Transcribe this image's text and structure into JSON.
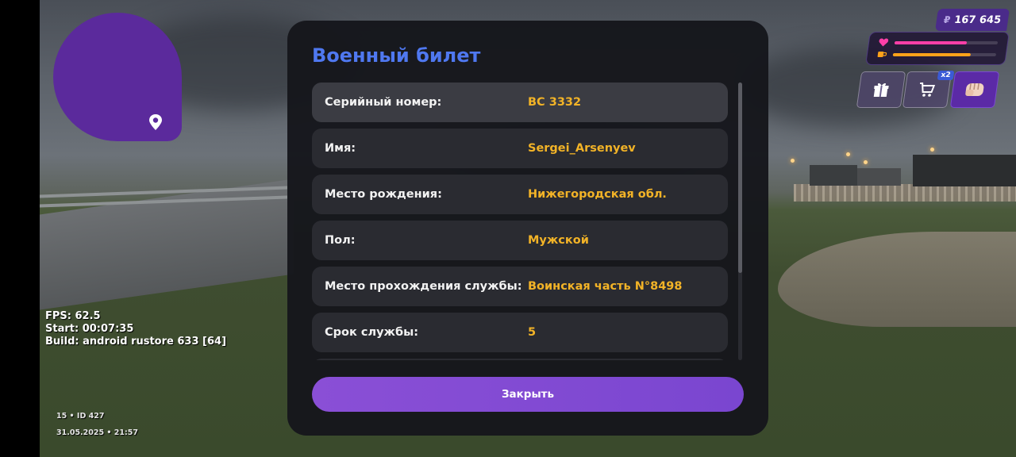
{
  "hud": {
    "money_currency": "₽",
    "money_amount": "167 645",
    "health_level": 0.7,
    "hunger_level": 0.75,
    "health_color": "#ff3fa8",
    "hunger_color": "#ffa21a",
    "cart_badge": "x2",
    "buttons": [
      "gift-icon",
      "cart-icon",
      "fist-icon"
    ]
  },
  "debug": {
    "fps": "FPS: 62.5",
    "start": "Start: 00:07:35",
    "build": "Build: android rustore 633 [64]"
  },
  "meta": {
    "line1": "15 • ID 427",
    "line2": "31.05.2025 • 21:57"
  },
  "modal": {
    "title": "Военный билет",
    "rows": [
      {
        "label": "Серийный номер:",
        "value": "ВС 3332"
      },
      {
        "label": "Имя:",
        "value": "Sergei_Arsenyev"
      },
      {
        "label": "Место рождения:",
        "value": "Нижегородская обл."
      },
      {
        "label": "Пол:",
        "value": "Мужской"
      },
      {
        "label": "Место прохождения службы:",
        "value": "Воинская часть N°8498"
      },
      {
        "label": "Срок службы:",
        "value": "5"
      }
    ],
    "close_label": "Закрыть"
  },
  "colors": {
    "accent": "#4f78f0",
    "value": "#f2b327",
    "button": "#8a4fd6",
    "minimap": "#5b2a9c"
  }
}
